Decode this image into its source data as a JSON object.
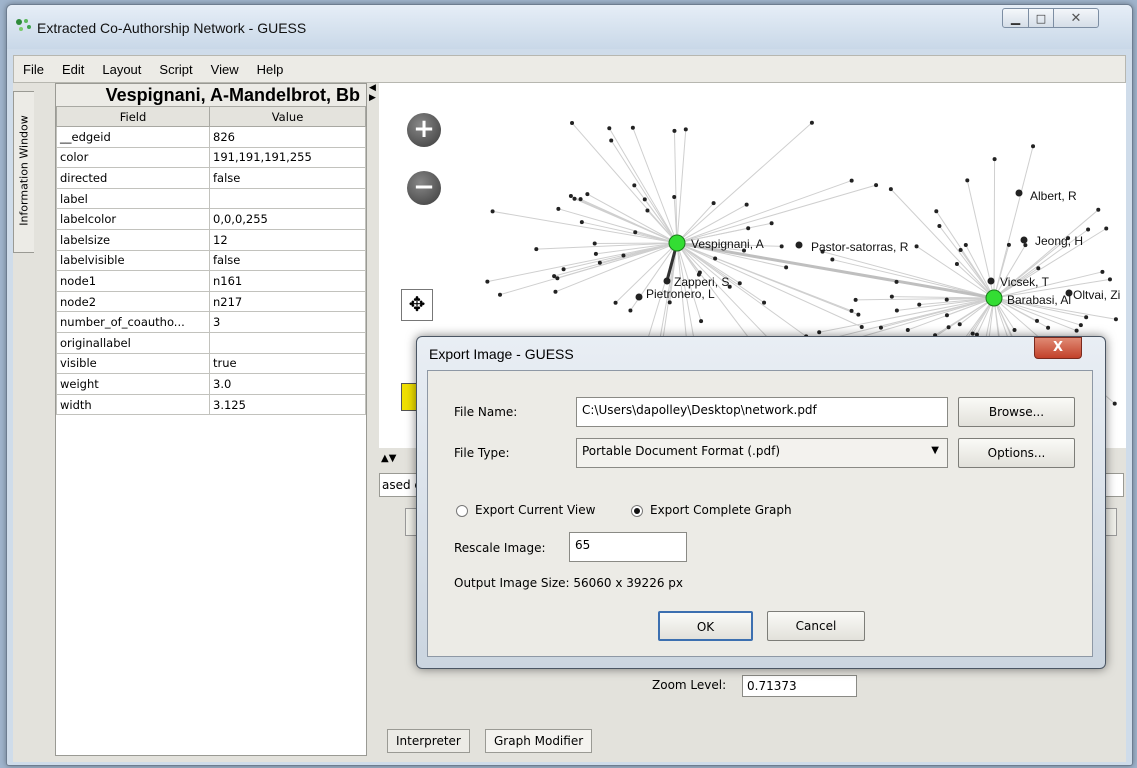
{
  "window": {
    "title": "Extracted Co-Authorship Network - GUESS"
  },
  "menu": [
    "File",
    "Edit",
    "Layout",
    "Script",
    "View",
    "Help"
  ],
  "info_panel": {
    "tab_label": "Information Window",
    "title": "Vespignani, A-Mandelbrot, Bb",
    "columns": [
      "Field",
      "Value"
    ],
    "rows": [
      {
        "field": "__edgeid",
        "value": "826"
      },
      {
        "field": "color",
        "value": "191,191,191,255"
      },
      {
        "field": "directed",
        "value": "false"
      },
      {
        "field": "label",
        "value": ""
      },
      {
        "field": "labelcolor",
        "value": "0,0,0,255"
      },
      {
        "field": "labelsize",
        "value": "12"
      },
      {
        "field": "labelvisible",
        "value": "false"
      },
      {
        "field": "node1",
        "value": "n161"
      },
      {
        "field": "node2",
        "value": "n217"
      },
      {
        "field": "number_of_coautho...",
        "value": "3"
      },
      {
        "field": "originallabel",
        "value": ""
      },
      {
        "field": "visible",
        "value": "true"
      },
      {
        "field": "weight",
        "value": "3.0"
      },
      {
        "field": "width",
        "value": "3.125"
      }
    ]
  },
  "graph": {
    "node_labels": [
      "Vespignani, A",
      "Pastor-satorras, R",
      "Zapperi, S",
      "Pietronero, L",
      "Albert, R",
      "Jeong, H",
      "Vicsek, T",
      "Barabasi, Al",
      "Oltvai, Zi"
    ],
    "accent_node_color": "#33dd33"
  },
  "lower": {
    "script_text": "ased c",
    "zoom_label": "Zoom Level:",
    "zoom_value": "0.71373",
    "tabs": [
      "Interpreter",
      "Graph Modifier"
    ]
  },
  "dialog": {
    "title": "Export Image - GUESS",
    "close_label": "X",
    "file_name_label": "File Name:",
    "file_name_value": "C:\\Users\\dapolley\\Desktop\\network.pdf",
    "browse_label": "Browse...",
    "file_type_label": "File Type:",
    "file_type_value": "Portable Document Format (.pdf)",
    "options_label": "Options...",
    "radio_current": "Export Current View",
    "radio_complete": "Export Complete Graph",
    "rescale_label": "Rescale Image:",
    "rescale_value": "65",
    "output_size": "Output Image Size: 56060 x 39226 px",
    "ok_label": "OK",
    "cancel_label": "Cancel"
  }
}
